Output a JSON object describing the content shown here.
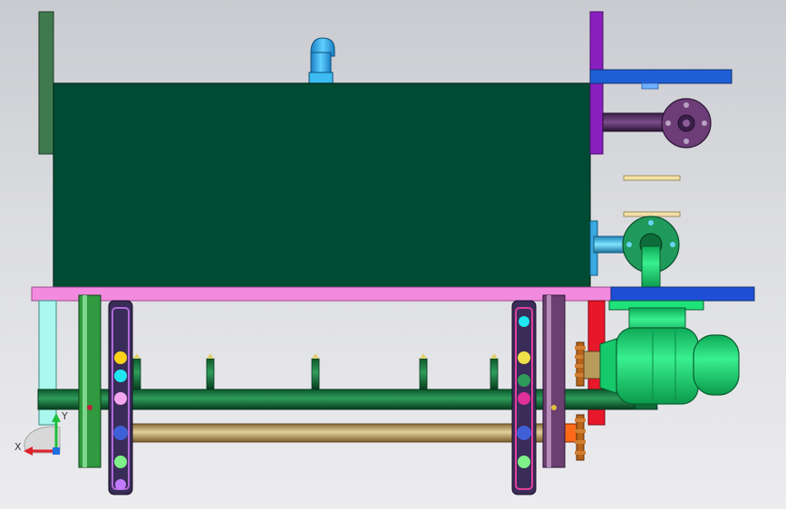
{
  "triad": {
    "x_label": "X",
    "y_label": "Y"
  },
  "colors": {
    "tank": "#004b33",
    "base_plate": "#f28bdf",
    "left_flange": "#3f7a4e",
    "right_flange": "#8a1fbf",
    "blue_bracket": "#1f5fd6",
    "motor": "#1fe27a",
    "pipe_green": "#0a6b32",
    "shaft": "#b89a5a",
    "inlet_pipe": "#2aa6e8",
    "red_strip": "#e8172a",
    "cyan_leg": "#a9f7ef"
  },
  "icons": [
    "coordinate-triad-icon"
  ]
}
